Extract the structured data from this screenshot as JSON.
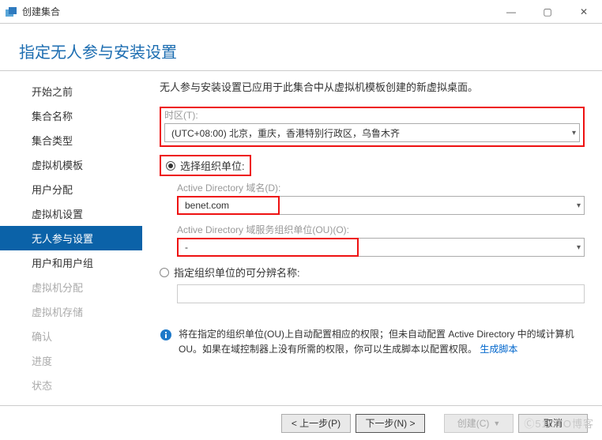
{
  "window": {
    "title": "创建集合",
    "min_icon": "—",
    "max_icon": "▢",
    "close_icon": "✕"
  },
  "header": {
    "title": "指定无人参与安装设置"
  },
  "sidebar": {
    "items": [
      {
        "label": "开始之前",
        "state": "normal"
      },
      {
        "label": "集合名称",
        "state": "normal"
      },
      {
        "label": "集合类型",
        "state": "normal"
      },
      {
        "label": "虚拟机模板",
        "state": "normal"
      },
      {
        "label": "用户分配",
        "state": "normal"
      },
      {
        "label": "虚拟机设置",
        "state": "normal"
      },
      {
        "label": "无人参与设置",
        "state": "active"
      },
      {
        "label": "用户和用户组",
        "state": "normal"
      },
      {
        "label": "虚拟机分配",
        "state": "disabled"
      },
      {
        "label": "虚拟机存储",
        "state": "disabled"
      },
      {
        "label": "确认",
        "state": "disabled"
      },
      {
        "label": "进度",
        "state": "disabled"
      },
      {
        "label": "状态",
        "state": "disabled"
      }
    ]
  },
  "content": {
    "description": "无人参与安装设置已应用于此集合中从虚拟机模板创建的新虚拟桌面。",
    "timezone": {
      "label": "时区(T):",
      "value": "(UTC+08:00) 北京，重庆，香港特别行政区，乌鲁木齐"
    },
    "radio1": {
      "label": "选择组织单位:"
    },
    "ad_domain": {
      "label": "Active Directory 域名(D):",
      "value": "benet.com"
    },
    "ad_ou": {
      "label": "Active Directory 域服务组织单位(OU)(O):",
      "value": "-"
    },
    "radio2": {
      "label": "指定组织单位的可分辨名称:"
    },
    "info": {
      "text1": "将在指定的组织单位(OU)上自动配置相应的权限；但未自动配置 Active Directory 中的域计算机 OU。如果在域控制器上没有所需的权限，你可以生成脚本以配置权限。",
      "link": "生成脚本"
    }
  },
  "footer": {
    "prev": "< 上一步(P)",
    "next": "下一步(N) >",
    "create": "创建(C)",
    "cancel": "取消"
  },
  "watermark": "Ⓒ51CTO博客"
}
